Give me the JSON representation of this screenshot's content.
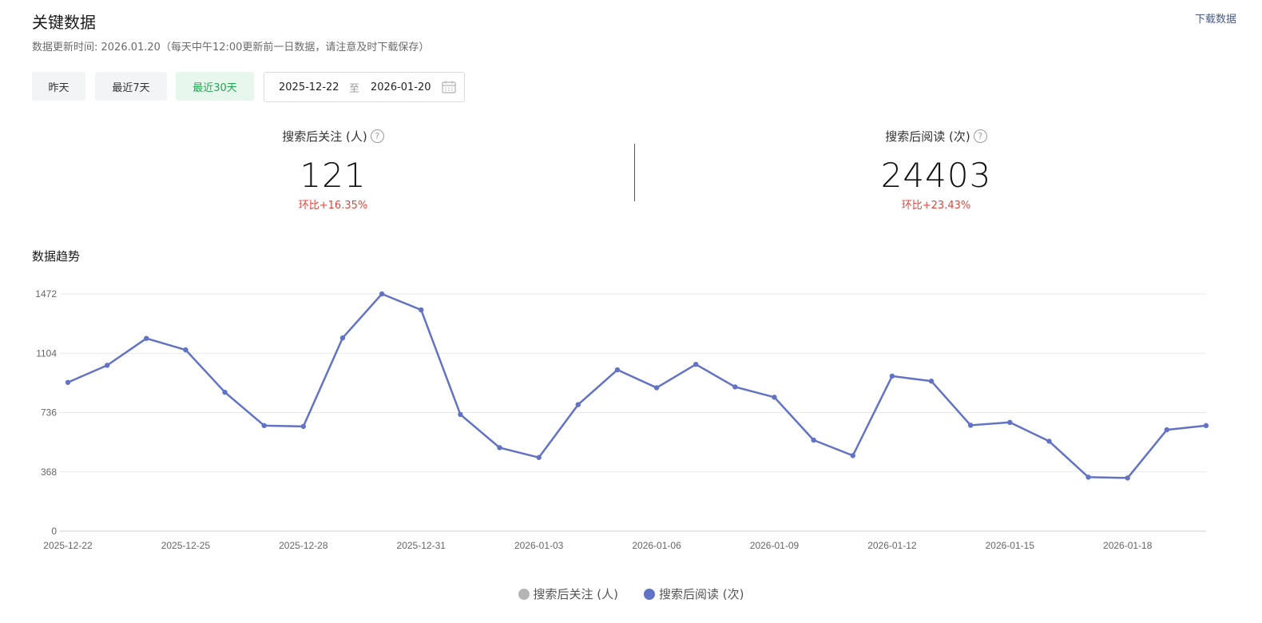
{
  "header": {
    "title": "关键数据",
    "subtitle": "数据更新时间: 2026.01.20（每天中午12:00更新前一日数据，请注意及时下载保存）",
    "download_label": "下载数据"
  },
  "filters": {
    "range_buttons": [
      {
        "label": "昨天",
        "active": false
      },
      {
        "label": "最近7天",
        "active": false
      },
      {
        "label": "最近30天",
        "active": true
      }
    ],
    "date_start": "2025-12-22",
    "date_separator": "至",
    "date_end": "2026-01-20"
  },
  "metrics": [
    {
      "label": "搜索后关注 (人)",
      "value": "121",
      "change": "环比+16.35%"
    },
    {
      "label": "搜索后阅读 (次)",
      "value": "24403",
      "change": "环比+23.43%"
    }
  ],
  "trend": {
    "title": "数据趋势",
    "legend": [
      {
        "name": "搜索后关注 (人)",
        "color": "#b5b5b5"
      },
      {
        "name": "搜索后阅读 (次)",
        "color": "#6272c4"
      }
    ]
  },
  "chart_data": {
    "type": "line",
    "x": [
      "2025-12-22",
      "2025-12-23",
      "2025-12-24",
      "2025-12-25",
      "2025-12-26",
      "2025-12-27",
      "2025-12-28",
      "2025-12-29",
      "2025-12-30",
      "2025-12-31",
      "2026-01-01",
      "2026-01-02",
      "2026-01-03",
      "2026-01-04",
      "2026-01-05",
      "2026-01-06",
      "2026-01-07",
      "2026-01-08",
      "2026-01-09",
      "2026-01-10",
      "2026-01-11",
      "2026-01-12",
      "2026-01-13",
      "2026-01-14",
      "2026-01-15",
      "2026-01-16",
      "2026-01-17",
      "2026-01-18",
      "2026-01-19",
      "2026-01-20"
    ],
    "xtick_labels": [
      "2025-12-22",
      "2025-12-25",
      "2025-12-28",
      "2025-12-31",
      "2026-01-03",
      "2026-01-06",
      "2026-01-09",
      "2026-01-12",
      "2026-01-15",
      "2026-01-18"
    ],
    "yticks": [
      0,
      368,
      736,
      1104,
      1472
    ],
    "ylim": [
      0,
      1472
    ],
    "grid": true,
    "legend_position": "bottom",
    "series": [
      {
        "name": "搜索后阅读 (次)",
        "color": "#6272c4",
        "values": [
          923,
          1029,
          1196,
          1125,
          862,
          655,
          650,
          1199,
          1472,
          1373,
          724,
          518,
          457,
          785,
          1001,
          890,
          1035,
          895,
          831,
          565,
          469,
          962,
          931,
          657,
          675,
          558,
          335,
          330,
          629,
          655
        ]
      }
    ]
  }
}
